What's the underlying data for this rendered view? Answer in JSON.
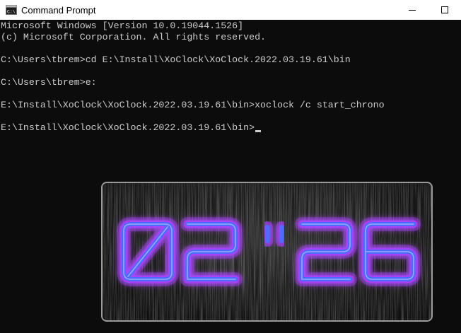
{
  "window": {
    "title": "Command Prompt",
    "icon": "cmd-app-icon",
    "controls": [
      "minimize-icon",
      "maximize-icon"
    ]
  },
  "console": {
    "lines": [
      "Microsoft Windows [Version 10.0.19044.1526]",
      "(c) Microsoft Corporation. All rights reserved.",
      "",
      "C:\\Users\\tbrem>cd E:\\Install\\XoClock\\XoClock.2022.03.19.61\\bin",
      "",
      "C:\\Users\\tbrem>e:",
      "",
      "E:\\Install\\XoClock\\XoClock.2022.03.19.61\\bin>xoclock /c start_chrono",
      "",
      "E:\\Install\\XoClock\\XoClock.2022.03.19.61\\bin>"
    ],
    "cursor": "underscore-cursor"
  },
  "clock": {
    "minutes": "02",
    "separator": "''",
    "seconds": "26",
    "digit_color": "#4f6bff",
    "glow_color": "#b23cff",
    "background": "brushed-dark-metal"
  },
  "colors": {
    "console_bg": "#0c0c0c",
    "console_text": "#cccccc",
    "titlebar_bg": "#ffffff",
    "clock_border": "#9a9a9a"
  }
}
